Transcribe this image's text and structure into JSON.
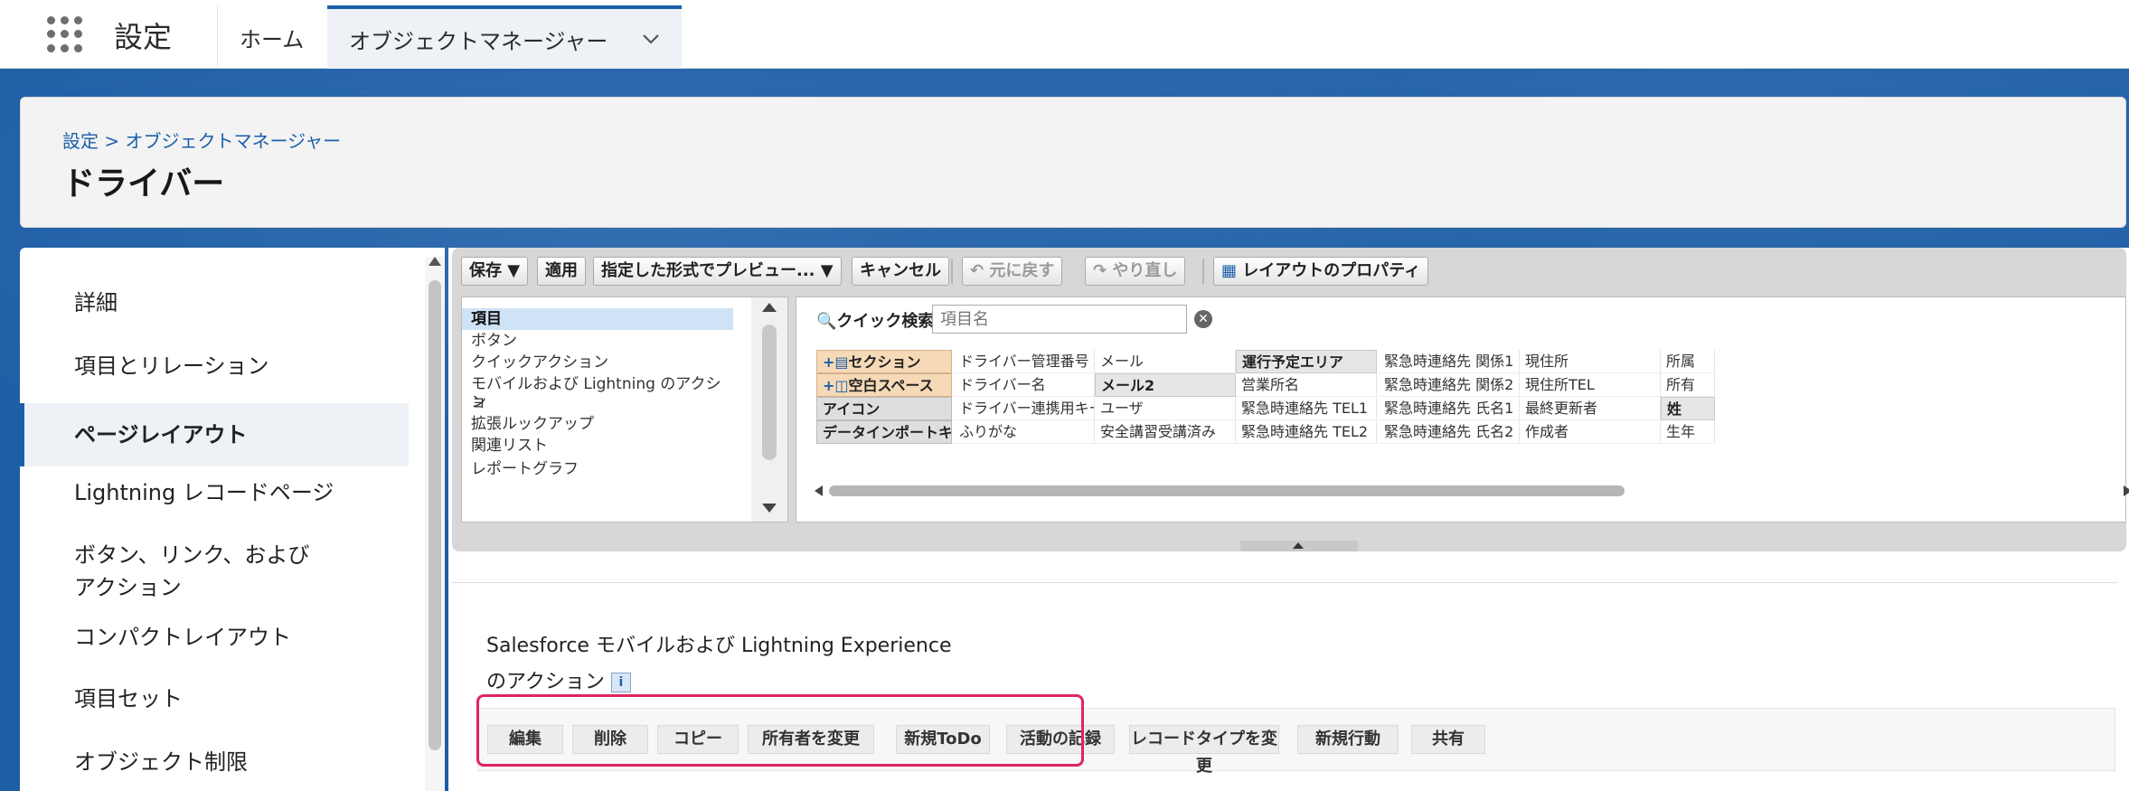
{
  "topnav": {
    "app_name": "設定",
    "home_tab": "ホーム",
    "object_manager_tab": "オブジェクトマネージャー"
  },
  "header": {
    "breadcrumb": "設定 > オブジェクトマネージャー",
    "title": "ドライバー"
  },
  "sidebar": {
    "items": [
      {
        "label": "詳細",
        "active": false
      },
      {
        "label": "項目とリレーション",
        "active": false
      },
      {
        "label": "ページレイアウト",
        "active": true
      },
      {
        "label": "Lightning レコードページ",
        "active": false
      },
      {
        "label": "ボタン、リンク、およびアクション",
        "active": false
      },
      {
        "label": "コンパクトレイアウト",
        "active": false
      },
      {
        "label": "項目セット",
        "active": false
      },
      {
        "label": "オブジェクト制限",
        "active": false
      }
    ]
  },
  "toolbar": {
    "save": "保存 ▼",
    "apply": "適用",
    "preview": "指定した形式でプレビュー... ▼",
    "cancel": "キャンセル",
    "undo": "元に戻す",
    "redo": "やり直し",
    "layout_properties": "レイアウトのプロパティ"
  },
  "palette": {
    "categories": [
      "項目",
      "ボタン",
      "クイックアクション",
      "モバイルおよび Lightning のアクショ",
      "ン",
      "拡張ルックアップ",
      "関連リスト",
      "レポートグラフ"
    ],
    "quick_search_label": "クイック検索",
    "quick_search_placeholder": "項目名",
    "fields": [
      [
        "セクション",
        "ドライバー管理番号",
        "メール",
        "運行予定エリア",
        "緊急時連絡先 関係1",
        "現住所",
        "所属"
      ],
      [
        "空白スペース",
        "ドライバー名",
        "メール2",
        "営業所名",
        "緊急時連絡先 関係2",
        "現住所TEL",
        "所有"
      ],
      [
        "アイコン",
        "ドライバー連携用キー",
        "ユーザ",
        "緊急時連絡先 TEL1",
        "緊急時連絡先 氏名1",
        "最終更新者",
        "姓"
      ],
      [
        "データインポートキー",
        "ふりがな",
        "安全講習受講済み",
        "緊急時連絡先 TEL2",
        "緊急時連絡先 氏名2",
        "作成者",
        "生年"
      ]
    ]
  },
  "actions": {
    "title_line1": "Salesforce モバイルおよび Lightning Experience",
    "title_line2": "のアクション",
    "info": "i",
    "buttons": [
      "編集",
      "削除",
      "コピー",
      "所有者を変更",
      "新規ToDo",
      "活動の記録",
      "レコードタイプを変更",
      "新規行動",
      "共有"
    ]
  },
  "colors": {
    "brand_blue": "#1b5faa",
    "band_blue": "#1d5ea6",
    "highlight": "#e0245e",
    "special_field": "#f6d9b7"
  }
}
